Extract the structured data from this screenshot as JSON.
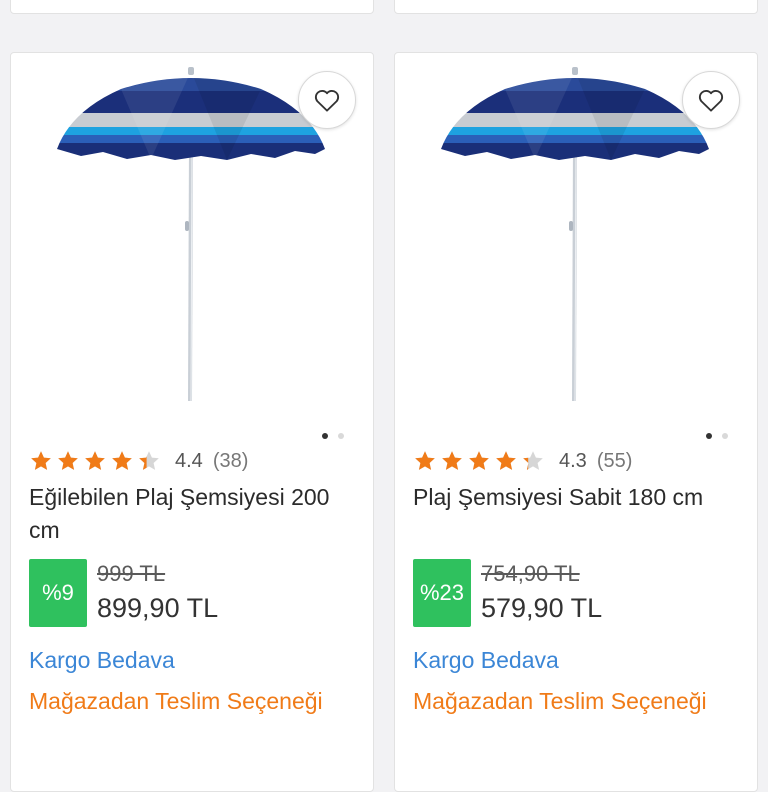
{
  "products": [
    {
      "rating_value": 4.4,
      "rating_score": "4.4",
      "rating_count": "(38)",
      "title": "Eğilebilen Plaj Şemsiyesi 200 cm",
      "discount": "%9",
      "old_price": "999 TL",
      "new_price": "899,90 TL",
      "cargo": "Kargo Bedava",
      "store_pickup": "Mağazadan Teslim Seçeneği",
      "image_index": 1,
      "image_total": 2
    },
    {
      "rating_value": 4.3,
      "rating_score": "4.3",
      "rating_count": "(55)",
      "title": "Plaj Şemsiyesi Sabit 180 cm",
      "discount": "%23",
      "old_price": "754,90 TL",
      "new_price": "579,90 TL",
      "cargo": "Kargo Bedava",
      "store_pickup": "Mağazadan Teslim Seçeneği",
      "image_index": 1,
      "image_total": 2
    }
  ],
  "icons": {
    "favorite": "heart-outline-icon",
    "star": "star-icon"
  },
  "colors": {
    "star": "#f07b18",
    "star_empty": "#d6d6d6",
    "discount_badge": "#2fc15e",
    "cargo_link": "#3b86d6",
    "store_pickup": "#f07b18"
  }
}
